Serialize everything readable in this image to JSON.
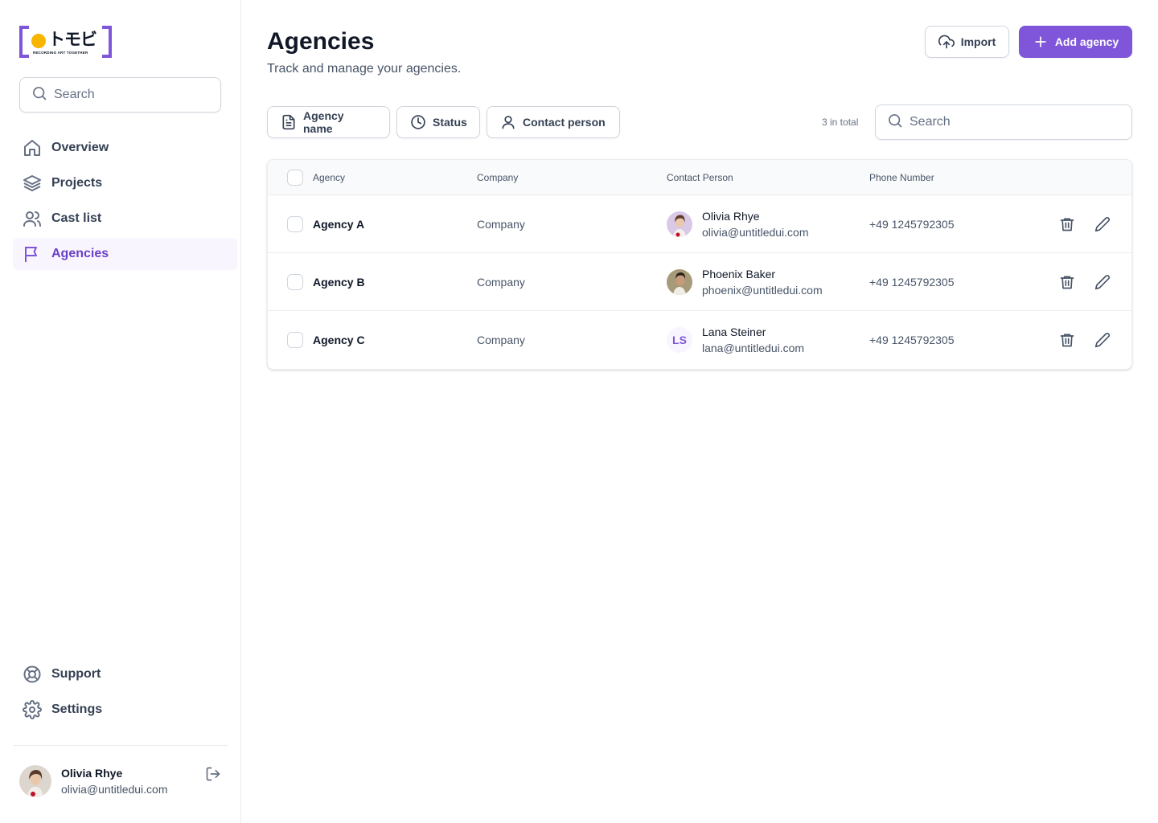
{
  "brand": {
    "logo_mark": "トモビ",
    "logo_tagline": "RECORDING ART TOGETHER"
  },
  "sidebar": {
    "search_placeholder": "Search",
    "items": [
      {
        "label": "Overview",
        "icon": "home-icon"
      },
      {
        "label": "Projects",
        "icon": "layers-icon"
      },
      {
        "label": "Cast list",
        "icon": "users-icon"
      },
      {
        "label": "Agencies",
        "icon": "flag-icon",
        "active": true
      }
    ],
    "bottom_items": [
      {
        "label": "Support",
        "icon": "life-buoy-icon"
      },
      {
        "label": "Settings",
        "icon": "gear-icon"
      }
    ],
    "user": {
      "name": "Olivia Rhye",
      "email": "olivia@untitledui.com"
    }
  },
  "header": {
    "title": "Agencies",
    "subtitle": "Track and manage your agencies.",
    "import_label": "Import",
    "add_label": "Add agency"
  },
  "filters": {
    "agency_name": "Agency name",
    "status": "Status",
    "contact_person": "Contact person",
    "total_text": "3 in total",
    "search_placeholder": "Search"
  },
  "table": {
    "columns": {
      "agency": "Agency",
      "company": "Company",
      "contact": "Contact Person",
      "phone": "Phone Number"
    },
    "rows": [
      {
        "agency": "Agency A",
        "company": "Company",
        "contact_name": "Olivia Rhye",
        "contact_email": "olivia@untitledui.com",
        "phone": "+49 1245792305",
        "avatar": "photo"
      },
      {
        "agency": "Agency B",
        "company": "Company",
        "contact_name": "Phoenix Baker",
        "contact_email": "phoenix@untitledui.com",
        "phone": "+49 1245792305",
        "avatar": "photo"
      },
      {
        "agency": "Agency C",
        "company": "Company",
        "contact_name": "Lana Steiner",
        "contact_email": "lana@untitledui.com",
        "phone": "+49 1245792305",
        "avatar": "initials",
        "initials": "LS"
      }
    ]
  },
  "colors": {
    "accent": "#7f56d9",
    "accent_text": "#6941c6",
    "active_bg": "#f9f5ff",
    "logo_dot": "#f7b500"
  }
}
